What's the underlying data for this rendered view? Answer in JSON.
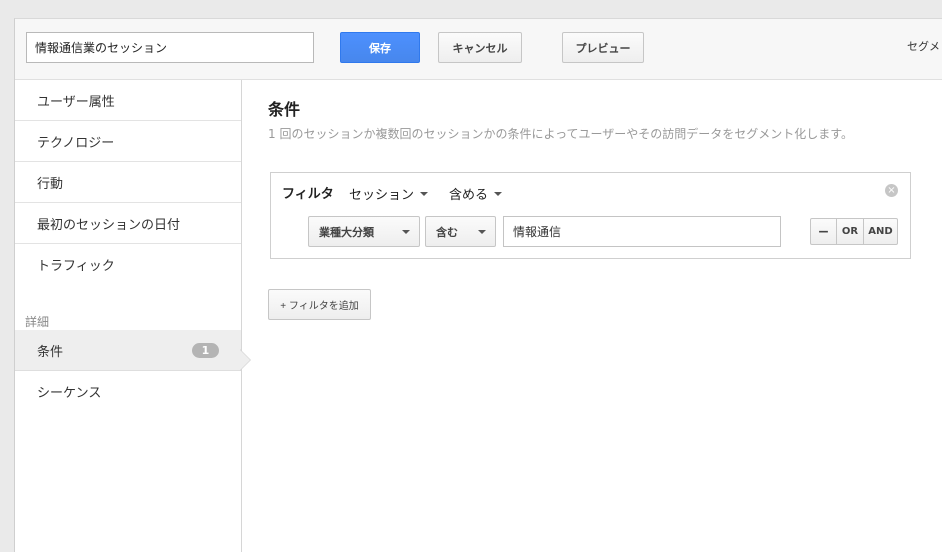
{
  "header": {
    "segment_name_value": "情報通信業のセッション",
    "save_label": "保存",
    "cancel_label": "キャンセル",
    "preview_label": "プレビュー",
    "segment_cut_label": "セグメ"
  },
  "sidebar": {
    "items": [
      {
        "label": "ユーザー属性"
      },
      {
        "label": "テクノロジー"
      },
      {
        "label": "行動"
      },
      {
        "label": "最初のセッションの日付"
      },
      {
        "label": "トラフィック"
      }
    ],
    "section_label": "詳細",
    "advanced": [
      {
        "label": "条件",
        "badge": "1"
      },
      {
        "label": "シーケンス"
      }
    ]
  },
  "main": {
    "title": "条件",
    "description": "1 回のセッションか複数回のセッションかの条件によってユーザーやその訪問データをセグメント化します。",
    "filter": {
      "label": "フィルタ",
      "scope": "セッション",
      "mode": "含める",
      "dimension": "業種大分類",
      "operator": "含む",
      "value": "情報通信",
      "minus_label": "−",
      "or_label": "OR",
      "and_label": "AND"
    },
    "add_filter_label": "+ フィルタを追加"
  },
  "colors": {
    "save_button": "#4d90fe",
    "badge": "#b4b4b4",
    "active_item": "#eeeeee"
  },
  "icons": [
    "caret-down-icon",
    "close-icon",
    "selection-pointer-icon"
  ]
}
